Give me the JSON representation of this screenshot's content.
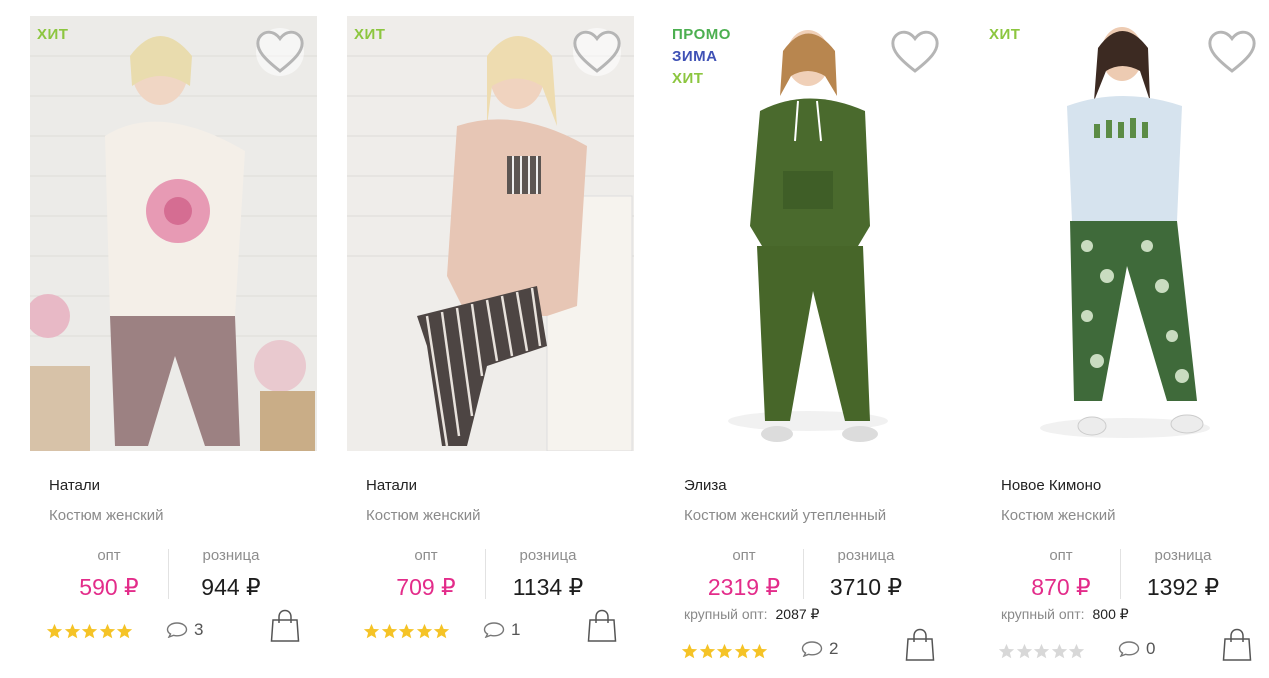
{
  "colors": {
    "accent_pink": "#e32c8a",
    "badge_hit": "#8cc63f",
    "badge_promo": "#4caf50",
    "badge_winter": "#3f51b5",
    "star_filled": "#f5c326",
    "star_empty": "#d8d8d8"
  },
  "labels": {
    "opt": "опт",
    "retail": "розница",
    "bulk": "крупный опт:"
  },
  "products": [
    {
      "name": "Натали",
      "type": "Костюм женский",
      "badges": [
        {
          "text": "ХИТ",
          "color": "#8cc63f"
        }
      ],
      "opt_price": "590 ₽",
      "retail_price": "944 ₽",
      "bulk_price": "",
      "rating": 5,
      "comments": "3",
      "icons": {
        "favorite": "heart-icon",
        "cart": "shopping-bag-icon",
        "comment": "speech-bubble-icon"
      }
    },
    {
      "name": "Натали",
      "type": "Костюм женский",
      "badges": [
        {
          "text": "ХИТ",
          "color": "#8cc63f"
        }
      ],
      "opt_price": "709 ₽",
      "retail_price": "1134 ₽",
      "bulk_price": "",
      "rating": 5,
      "comments": "1",
      "icons": {
        "favorite": "heart-icon",
        "cart": "shopping-bag-icon",
        "comment": "speech-bubble-icon"
      }
    },
    {
      "name": "Элиза",
      "type": "Костюм женский утепленный",
      "badges": [
        {
          "text": "ПРОМО",
          "color": "#4caf50"
        },
        {
          "text": "ЗИМА",
          "color": "#3f51b5"
        },
        {
          "text": "ХИТ",
          "color": "#8cc63f"
        }
      ],
      "opt_price": "2319 ₽",
      "retail_price": "3710 ₽",
      "bulk_price": "2087 ₽",
      "rating": 5,
      "comments": "2",
      "icons": {
        "favorite": "heart-icon",
        "cart": "shopping-bag-icon",
        "comment": "speech-bubble-icon"
      }
    },
    {
      "name": "Новое Кимоно",
      "type": "Костюм женский",
      "badges": [
        {
          "text": "ХИТ",
          "color": "#8cc63f"
        }
      ],
      "opt_price": "870 ₽",
      "retail_price": "1392 ₽",
      "bulk_price": "800 ₽",
      "rating": 0,
      "comments": "0",
      "icons": {
        "favorite": "heart-icon",
        "cart": "shopping-bag-icon",
        "comment": "speech-bubble-icon"
      }
    }
  ]
}
